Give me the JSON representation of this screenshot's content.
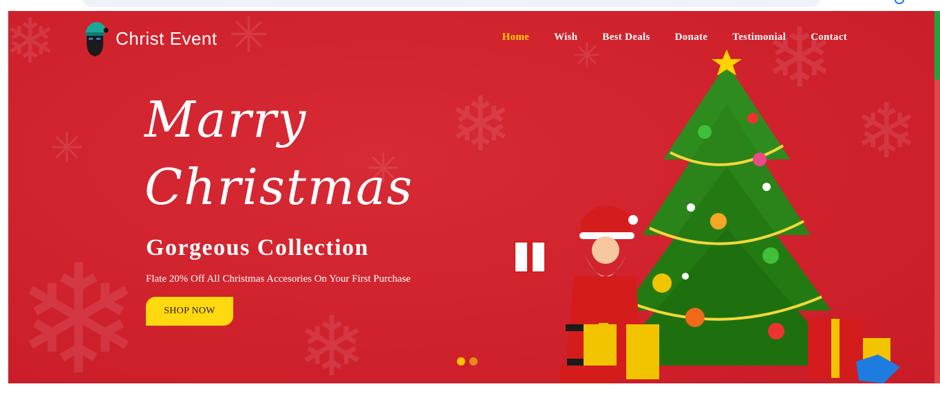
{
  "brand": {
    "name": "Christ Event"
  },
  "nav": {
    "items": [
      {
        "label": "Home",
        "active": true
      },
      {
        "label": "Wish"
      },
      {
        "label": "Best Deals"
      },
      {
        "label": "Donate"
      },
      {
        "label": "Testimonial"
      },
      {
        "label": "Contact"
      }
    ]
  },
  "hero": {
    "script_line1": "Marry",
    "script_line2": "Christmas",
    "headline": "Gorgeous Collection",
    "subline": "Flate 20% Off All Christmas Accesories On Your First Purchase",
    "cta_label": "SHOP NOW"
  },
  "slider": {
    "count": 2,
    "active_index": 0
  },
  "colors": {
    "hero_bg": "#d0222d",
    "accent_yellow": "#ffd90f",
    "nav_active": "#ffd400",
    "text": "#ffffff"
  },
  "icons": [
    "santa-logo-icon",
    "snowflake-icon",
    "globe-icon",
    "christmas-tree-icon",
    "santa-illustration-icon",
    "gift-box-icon",
    "star-icon"
  ]
}
